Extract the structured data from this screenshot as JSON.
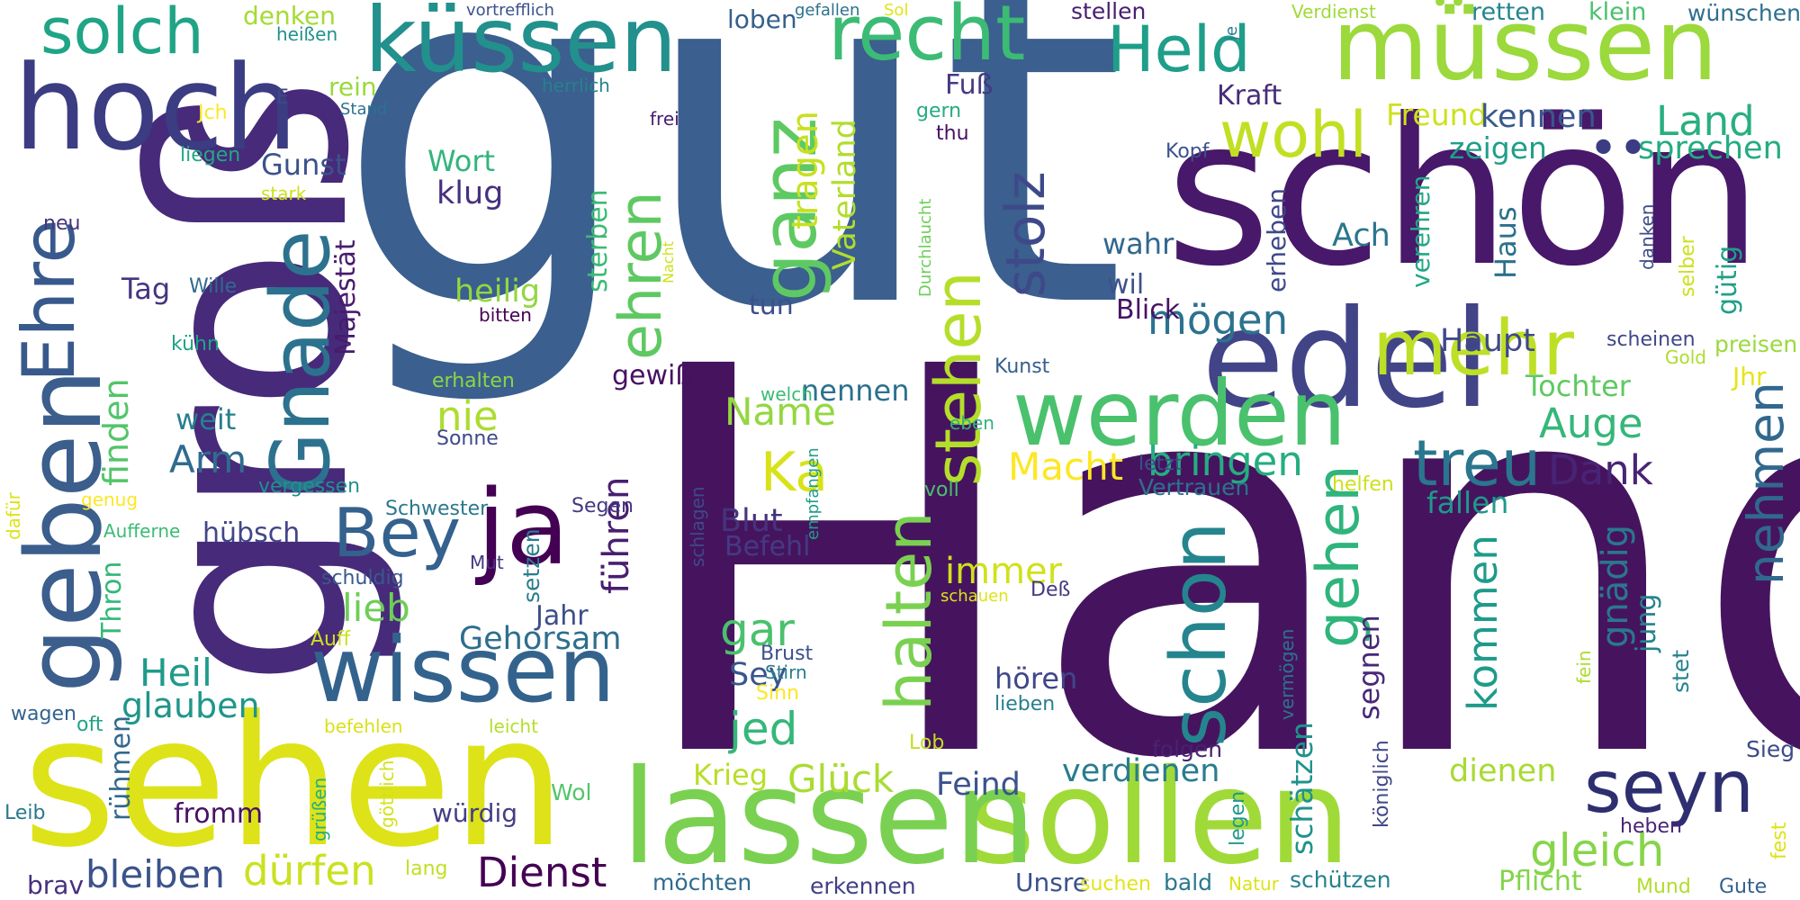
{
  "words": [
    {
      "text": "gut",
      "color": "#3b5f8e"
    },
    {
      "text": "Hand",
      "color": "#46145e"
    },
    {
      "text": "groß",
      "color": "#472a7a"
    },
    {
      "text": "schön",
      "color": "#48186a"
    },
    {
      "text": "sehen",
      "color": "#dde318"
    },
    {
      "text": "sollen",
      "color": "#a0da39"
    },
    {
      "text": "lassen",
      "color": "#7ad151"
    },
    {
      "text": "müssen",
      "color": "#9bd93c"
    },
    {
      "text": "hoch",
      "color": "#3b3c82"
    },
    {
      "text": "küssen",
      "color": "#22908c"
    },
    {
      "text": "recht",
      "color": "#3cbb75"
    },
    {
      "text": "edel",
      "color": "#414487"
    },
    {
      "text": "geben",
      "color": "#3b5e8c"
    },
    {
      "text": "Ehre",
      "color": "#38598c"
    },
    {
      "text": "wissen",
      "color": "#33638d"
    },
    {
      "text": "Gnade",
      "color": "#2c728e"
    },
    {
      "text": "ganz",
      "color": "#5ec962"
    },
    {
      "text": "werden",
      "color": "#4ac16d"
    },
    {
      "text": "Held",
      "color": "#1f9e89"
    },
    {
      "text": "ja",
      "color": "#440154"
    },
    {
      "text": "seyn",
      "color": "#2d2f70"
    },
    {
      "text": "schon",
      "color": "#25858e"
    },
    {
      "text": "halten",
      "color": "#7ad151"
    },
    {
      "text": "stehen",
      "color": "#b5de2b"
    },
    {
      "text": "mehr",
      "color": "#bddf26"
    },
    {
      "text": "treu",
      "color": "#2a768e"
    },
    {
      "text": "Bey",
      "color": "#34618d"
    },
    {
      "text": "wohl",
      "color": "#c2df23"
    },
    {
      "text": "ehren",
      "color": "#5ec962"
    },
    {
      "text": "stolz",
      "color": "#3e4989"
    },
    {
      "text": "solch",
      "color": "#20a486"
    },
    {
      "text": "gehen",
      "color": "#2fb47c"
    },
    {
      "text": "nehmen",
      "color": "#31688e"
    },
    {
      "text": "gleich",
      "color": "#86d549"
    },
    {
      "text": "Ka",
      "color": "#d8e219"
    },
    {
      "text": "Dienst",
      "color": "#440154"
    },
    {
      "text": "dürfen",
      "color": "#cae11f"
    },
    {
      "text": "bleiben",
      "color": "#3b528b"
    },
    {
      "text": "gar",
      "color": "#4ac16d"
    },
    {
      "text": "jed",
      "color": "#35b779"
    },
    {
      "text": "Glück",
      "color": "#aadc32"
    },
    {
      "text": "bringen",
      "color": "#26ad81"
    },
    {
      "text": "mögen",
      "color": "#2c728e"
    },
    {
      "text": "kommen",
      "color": "#1e9b8a"
    },
    {
      "text": "Dank",
      "color": "#482475"
    },
    {
      "text": "Auge",
      "color": "#35b779"
    },
    {
      "text": "gnädig",
      "color": "#2a778e"
    },
    {
      "text": "immer",
      "color": "#d0e11c"
    },
    {
      "text": "Heil",
      "color": "#1f9a8a"
    },
    {
      "text": "glauben",
      "color": "#1f968b"
    },
    {
      "text": "finden",
      "color": "#52c569"
    },
    {
      "text": "lieb",
      "color": "#6ece58"
    },
    {
      "text": "Gehorsam",
      "color": "#2e6e8e"
    },
    {
      "text": "führen",
      "color": "#481f70"
    },
    {
      "text": "Macht",
      "color": "#fde725"
    },
    {
      "text": "Name",
      "color": "#93d741"
    },
    {
      "text": "tragen",
      "color": "#c8e020"
    },
    {
      "text": "Vaterland",
      "color": "#b2dd2d"
    },
    {
      "text": "Fuß",
      "color": "#443983"
    },
    {
      "text": "Freund",
      "color": "#cde11d"
    },
    {
      "text": "kennen",
      "color": "#38588c"
    },
    {
      "text": "Land",
      "color": "#29af7f"
    },
    {
      "text": "zeigen",
      "color": "#1f9e89"
    },
    {
      "text": "sprechen",
      "color": "#25ab82"
    },
    {
      "text": "Kraft",
      "color": "#472c7a"
    },
    {
      "text": "Haus",
      "color": "#2d708e"
    },
    {
      "text": "Ach",
      "color": "#2a768e"
    },
    {
      "text": "wahr",
      "color": "#31688e"
    },
    {
      "text": "wil",
      "color": "#3b528b"
    },
    {
      "text": "Blick",
      "color": "#471365"
    },
    {
      "text": "Haupt",
      "color": "#3e4989"
    },
    {
      "text": "Tochter",
      "color": "#5ec962"
    },
    {
      "text": "verdienen",
      "color": "#287c8e"
    },
    {
      "text": "schätzen",
      "color": "#20928c"
    },
    {
      "text": "dienen",
      "color": "#a8db34"
    },
    {
      "text": "hören",
      "color": "#3f4788"
    },
    {
      "text": "segnen",
      "color": "#482878"
    },
    {
      "text": "jung",
      "color": "#25838e"
    },
    {
      "text": "Feind",
      "color": "#3a548c"
    },
    {
      "text": "Krieg",
      "color": "#b8de29"
    },
    {
      "text": "Sey",
      "color": "#39568c"
    },
    {
      "text": "Blut",
      "color": "#46337e"
    },
    {
      "text": "Befehl",
      "color": "#443a83"
    },
    {
      "text": "nennen",
      "color": "#2c718e"
    },
    {
      "text": "nie",
      "color": "#addc30"
    },
    {
      "text": "heilig",
      "color": "#93d741"
    },
    {
      "text": "Arm",
      "color": "#2f6c8e"
    },
    {
      "text": "weit",
      "color": "#277f8e"
    },
    {
      "text": "Wort",
      "color": "#31b57b"
    },
    {
      "text": "klug",
      "color": "#46307e"
    },
    {
      "text": "Gunst",
      "color": "#3b528b"
    },
    {
      "text": "Majestät",
      "color": "#481b6d"
    },
    {
      "text": "Tag",
      "color": "#453581"
    },
    {
      "text": "hübsch",
      "color": "#404688"
    },
    {
      "text": "Thron",
      "color": "#35b779"
    },
    {
      "text": "rühmen",
      "color": "#31688e"
    },
    {
      "text": "fromm",
      "color": "#471164"
    },
    {
      "text": "würdig",
      "color": "#433e85"
    },
    {
      "text": "Jahr",
      "color": "#3d4e8a"
    },
    {
      "text": "setzen",
      "color": "#287d8e"
    },
    {
      "text": "tun",
      "color": "#3c508b"
    },
    {
      "text": "sterben",
      "color": "#3bbb75"
    },
    {
      "text": "gewiß",
      "color": "#471063"
    },
    {
      "text": "Vertrauen",
      "color": "#2c738e"
    },
    {
      "text": "fallen",
      "color": "#1f998a"
    },
    {
      "text": "verehren",
      "color": "#22a884"
    },
    {
      "text": "erheben",
      "color": "#3f4889"
    },
    {
      "text": "gütig",
      "color": "#1fa088"
    },
    {
      "text": "denken",
      "color": "#a5db36"
    },
    {
      "text": "retten",
      "color": "#25858e"
    },
    {
      "text": "klein",
      "color": "#4ac16d"
    },
    {
      "text": "wünschen",
      "color": "#2e6f8e"
    },
    {
      "text": "loben",
      "color": "#35608d"
    },
    {
      "text": "stellen",
      "color": "#482071"
    },
    {
      "text": "rein",
      "color": "#9bd93c"
    },
    {
      "text": "Kopf",
      "color": "#3b528b"
    },
    {
      "text": "Pflicht",
      "color": "#84d44b"
    },
    {
      "text": "Unsre",
      "color": "#3b518b"
    },
    {
      "text": "erkennen",
      "color": "#424086"
    },
    {
      "text": "möchten",
      "color": "#2f6c8e"
    },
    {
      "text": "schützen",
      "color": "#26828e"
    },
    {
      "text": "bald",
      "color": "#2a788e"
    },
    {
      "text": "Mund",
      "color": "#b2dd2d"
    },
    {
      "text": "Gute",
      "color": "#34618d"
    },
    {
      "text": "brav",
      "color": "#46307e"
    },
    {
      "text": "Leib",
      "color": "#2a788e"
    },
    {
      "text": "Sieg",
      "color": "#3e4a89"
    },
    {
      "text": "heben",
      "color": "#482576"
    },
    {
      "text": "fest",
      "color": "#dde318"
    },
    {
      "text": "preisen",
      "color": "#9bd93c"
    },
    {
      "text": "Jhr",
      "color": "#e5e419"
    },
    {
      "text": "Gold",
      "color": "#addc30"
    },
    {
      "text": "selber",
      "color": "#cde11d"
    },
    {
      "text": "danken",
      "color": "#3e4c8a"
    },
    {
      "text": "scheinen",
      "color": "#3f4788"
    },
    {
      "text": "stet",
      "color": "#26828e"
    },
    {
      "text": "fein",
      "color": "#addc30"
    },
    {
      "text": "königlich",
      "color": "#3f4889"
    },
    {
      "text": "vermögen",
      "color": "#2c738e"
    },
    {
      "text": "folgen",
      "color": "#482173"
    },
    {
      "text": "legen",
      "color": "#1f998a"
    },
    {
      "text": "Natur",
      "color": "#dce319"
    },
    {
      "text": "suchen",
      "color": "#e2e418"
    },
    {
      "text": "Lob",
      "color": "#c2df23"
    },
    {
      "text": "lieben",
      "color": "#277f8e"
    },
    {
      "text": "Deß",
      "color": "#453882"
    },
    {
      "text": "schauen",
      "color": "#dde318"
    },
    {
      "text": "helfen",
      "color": "#cde11d"
    },
    {
      "text": "letzt",
      "color": "#3c4f8a"
    },
    {
      "text": "voll",
      "color": "#4ac16d"
    },
    {
      "text": "eben",
      "color": "#2fb47c"
    },
    {
      "text": "Kunst",
      "color": "#355f8d"
    },
    {
      "text": "gern",
      "color": "#25ab82"
    },
    {
      "text": "thu",
      "color": "#471063"
    },
    {
      "text": "Durchlaucht",
      "color": "#6ece58"
    },
    {
      "text": "empfangen",
      "color": "#1f9e89"
    },
    {
      "text": "welch",
      "color": "#3bbb75"
    },
    {
      "text": "schlagen",
      "color": "#3e4989"
    },
    {
      "text": "Segen",
      "color": "#443983"
    },
    {
      "text": "Brust",
      "color": "#3b528b"
    },
    {
      "text": "Stirn",
      "color": "#287d8e"
    },
    {
      "text": "Sinn",
      "color": "#fde725"
    },
    {
      "text": "Sonne",
      "color": "#3e4989"
    },
    {
      "text": "erhalten",
      "color": "#8bd646"
    },
    {
      "text": "Schwester",
      "color": "#2a788e"
    },
    {
      "text": "Mut",
      "color": "#453781"
    },
    {
      "text": "schuldig",
      "color": "#38598c"
    },
    {
      "text": "vergessen",
      "color": "#21918c"
    },
    {
      "text": "genug",
      "color": "#fde725"
    },
    {
      "text": "Aufferne",
      "color": "#3bbb75"
    },
    {
      "text": "dafür",
      "color": "#dde318"
    },
    {
      "text": "Auff",
      "color": "#cde11d"
    },
    {
      "text": "wagen",
      "color": "#33638d"
    },
    {
      "text": "oft",
      "color": "#20a386"
    },
    {
      "text": "befehlen",
      "color": "#d8e219"
    },
    {
      "text": "leicht",
      "color": "#b5de2b"
    },
    {
      "text": "grüßen",
      "color": "#26ad81"
    },
    {
      "text": "göttlich",
      "color": "#d2e21b"
    },
    {
      "text": "Wol",
      "color": "#52c569"
    },
    {
      "text": "lang",
      "color": "#c2df23"
    },
    {
      "text": "Wille",
      "color": "#2f6b8e"
    },
    {
      "text": "bitten",
      "color": "#440154"
    },
    {
      "text": "kühn",
      "color": "#20a486"
    },
    {
      "text": "stark",
      "color": "#cde11d"
    },
    {
      "text": "neu",
      "color": "#46337e"
    },
    {
      "text": "liegen",
      "color": "#22a884"
    },
    {
      "text": "Jch",
      "color": "#fde725"
    },
    {
      "text": "E",
      "color": "#404688"
    },
    {
      "text": "heißen",
      "color": "#21918c"
    },
    {
      "text": "herrlich",
      "color": "#26828e"
    },
    {
      "text": "Stand",
      "color": "#2c728e"
    },
    {
      "text": "vortrefflich",
      "color": "#3b528b"
    },
    {
      "text": "gefallen",
      "color": "#2c728e"
    },
    {
      "text": "Sol",
      "color": "#e2e418"
    },
    {
      "text": "frei",
      "color": "#482071"
    },
    {
      "text": "Verdienst",
      "color": "#9fda3a"
    },
    {
      "text": "je",
      "color": "#2a788e"
    },
    {
      "text": "Nacht",
      "color": "#cde11d"
    },
    {
      "text": "o",
      "color": "#d8e219"
    }
  ]
}
